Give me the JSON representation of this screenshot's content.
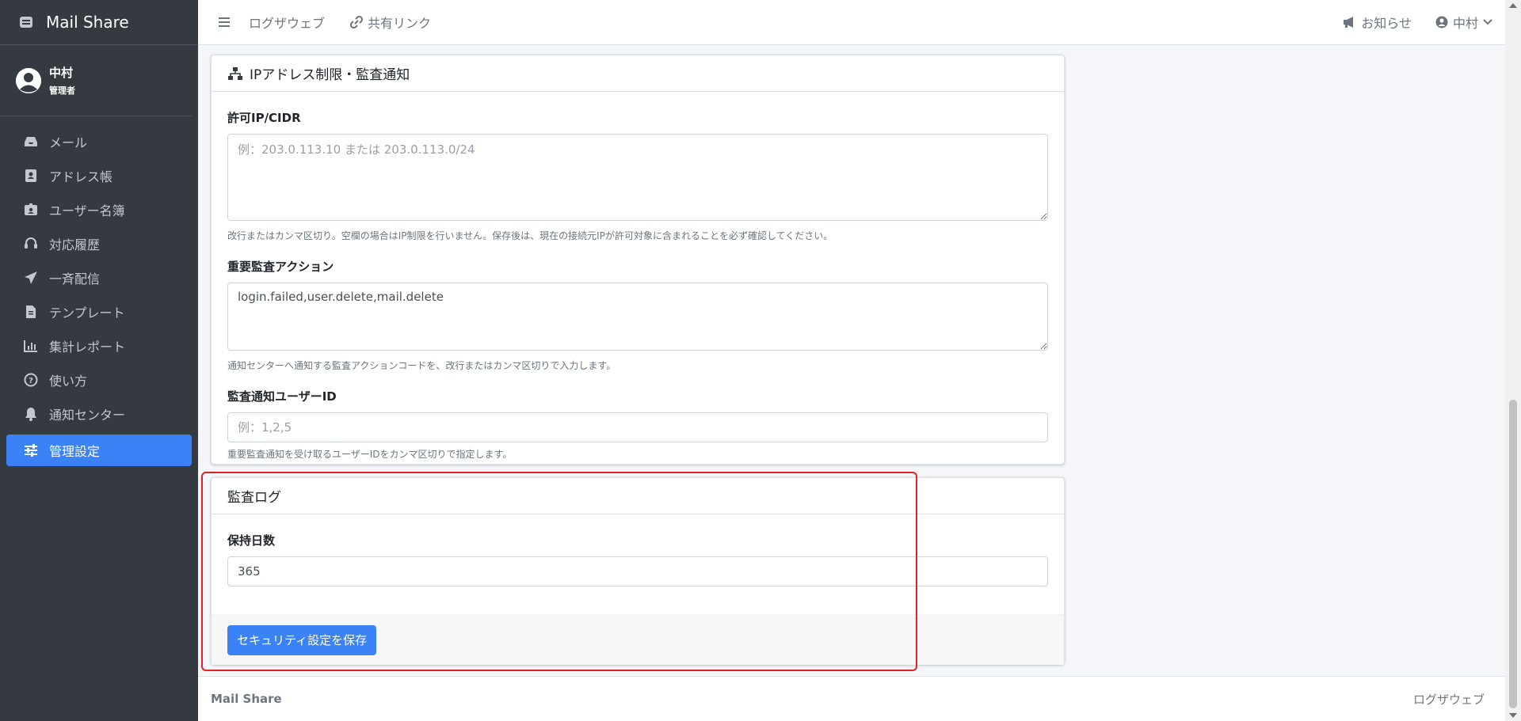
{
  "app": {
    "name": "Mail Share"
  },
  "user": {
    "name": "中村",
    "role": "管理者"
  },
  "sidebar": {
    "items": [
      {
        "label": "メール",
        "icon": "inbox-icon"
      },
      {
        "label": "アドレス帳",
        "icon": "address-book-icon"
      },
      {
        "label": "ユーザー名簿",
        "icon": "id-badge-icon"
      },
      {
        "label": "対応履歴",
        "icon": "headset-icon"
      },
      {
        "label": "一斉配信",
        "icon": "paper-plane-icon"
      },
      {
        "label": "テンプレート",
        "icon": "file-icon"
      },
      {
        "label": "集計レポート",
        "icon": "chart-icon"
      },
      {
        "label": "使い方",
        "icon": "question-icon"
      },
      {
        "label": "通知センター",
        "icon": "bell-icon"
      },
      {
        "label": "管理設定",
        "icon": "sliders-icon",
        "active": true
      }
    ]
  },
  "topbar": {
    "logviewer": "ログザウェブ",
    "shared_link": "共有リンク",
    "notice": "お知らせ",
    "user": "中村"
  },
  "ip_card": {
    "title": "IPアドレス制限・監査通知",
    "allowed_ip_label": "許可IP/CIDR",
    "allowed_ip_placeholder": "例：203.0.113.10 または 203.0.113.0/24",
    "allowed_ip_value": "",
    "allowed_ip_help": "改行またはカンマ区切り。空欄の場合はIP制限を行いません。保存後は、現在の接続元IPが許可対象に含まれることを必ず確認してください。",
    "audit_actions_label": "重要監査アクション",
    "audit_actions_value": "login.failed,user.delete,mail.delete",
    "audit_actions_help": "通知センターへ通知する監査アクションコードを、改行またはカンマ区切りで入力します。",
    "notify_users_label": "監査通知ユーザーID",
    "notify_users_placeholder": "例：1,2,5",
    "notify_users_value": "",
    "notify_users_help": "重要監査通知を受け取るユーザーIDをカンマ区切りで指定します。"
  },
  "audit_card": {
    "title": "監査ログ",
    "retention_label": "保持日数",
    "retention_value": "365",
    "save_label": "セキュリティ設定を保存"
  },
  "footer": {
    "brand": "Mail Share",
    "right": "ログザウェブ"
  },
  "colors": {
    "sidebar_bg": "#343a40",
    "accent": "#3b82f6",
    "highlight": "#e02424"
  }
}
